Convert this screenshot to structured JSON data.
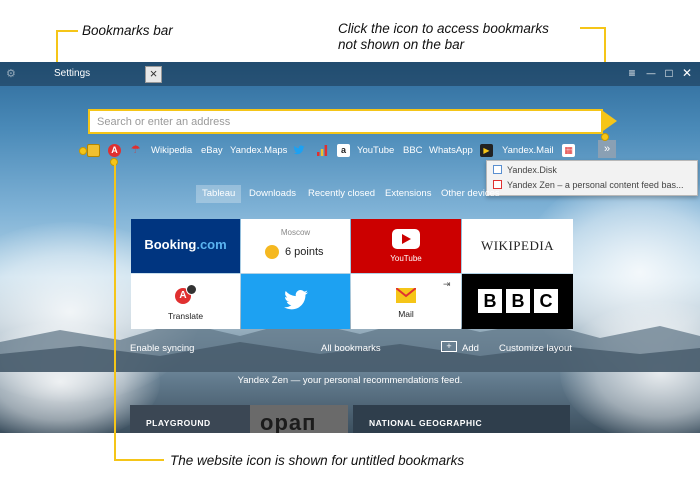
{
  "callouts": {
    "bookmarks_bar": "Bookmarks bar",
    "access_line1": "Click the icon to access bookmarks",
    "access_line2": "not shown on the bar",
    "website_icon": "The website icon is shown for untitled bookmarks"
  },
  "window": {
    "tab_title": "Settings",
    "tab_close": "×",
    "controls": {
      "menu": "≡",
      "minimize": "—",
      "maximize": "□",
      "close": "✕"
    }
  },
  "search": {
    "placeholder": "Search or enter an address"
  },
  "bookmarks_bar": {
    "items": [
      "Wikipedia",
      "eBay",
      "Yandex.Maps",
      "YouTube",
      "BBC",
      "WhatsApp",
      "Yandex.Mail"
    ],
    "more": "»",
    "icons": {
      "folder": "folder-icon",
      "translate": "translate-icon",
      "umbrella": "umbrella-icon",
      "twitter": "twitter-icon",
      "signal": "signal-icon",
      "amazon": "amazon-icon",
      "play": "play-icon",
      "calendar": "calendar-icon"
    },
    "icon_text": {
      "amazon": "a",
      "translate": "A",
      "calendar": "▦"
    }
  },
  "overflow_dropdown": {
    "items": [
      "Yandex.Disk",
      "Yandex Zen – a personal content feed bas..."
    ]
  },
  "nav_tabs": {
    "tableau": "Tableau",
    "downloads": "Downloads",
    "recently_closed": "Recently closed",
    "extensions": "Extensions",
    "other_devices": "Other devices"
  },
  "tiles": {
    "booking": {
      "brand": "Booking",
      "suffix": ".com"
    },
    "weather": {
      "city": "Moscow",
      "value": "6 points"
    },
    "youtube": {
      "label": "YouTube"
    },
    "wikipedia": {
      "brand": "WIKIPEDIA"
    },
    "translate": {
      "label": "Translate",
      "glyph": "A"
    },
    "twitter": {
      "icon": "twitter-bird-icon"
    },
    "mail": {
      "label": "Mail"
    },
    "bbc": {
      "letters": [
        "B",
        "B",
        "C"
      ]
    }
  },
  "bottom": {
    "enable_syncing": "Enable syncing",
    "all_bookmarks": "All bookmarks",
    "add": "Add",
    "customize": "Customize layout",
    "zen": "Yandex Zen — your personal recommendations feed."
  },
  "cards": {
    "left": "PLAYGROUND",
    "middle": "орап",
    "right": "NATIONAL GEOGRAPHIC"
  },
  "colors": {
    "accent": "#f5c518",
    "booking": "#003580",
    "youtube": "#cc0000",
    "twitter": "#1da1f2",
    "bbc": "#000000"
  }
}
